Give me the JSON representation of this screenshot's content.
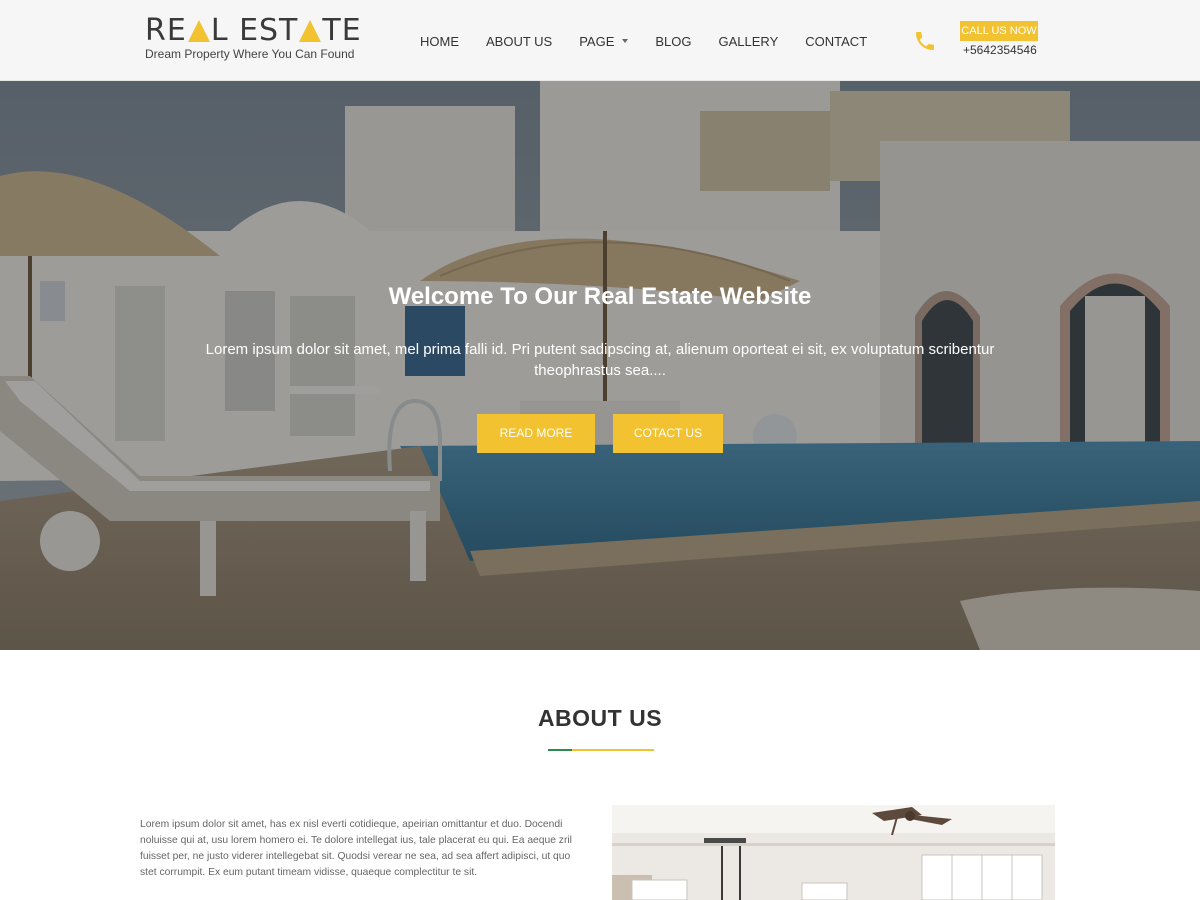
{
  "logo": {
    "title_part1": "RE",
    "title_part2": "L EST",
    "title_part3": "TE",
    "tagline": "Dream Property Where You Can Found"
  },
  "nav": {
    "items": [
      "HOME",
      "ABOUT US",
      "PAGE",
      "BLOG",
      "GALLERY",
      "CONTACT"
    ]
  },
  "contact": {
    "call_label": "CALL US NOW",
    "phone": "+5642354546",
    "icon": "phone-icon"
  },
  "hero": {
    "title": "Welcome To Our Real Estate Website",
    "text": "Lorem ipsum dolor sit amet, mel prima falli id. Pri putent sadipscing at, alienum oporteat ei sit, ex voluptatum scribentur theophrastus sea....",
    "read_more": "READ MORE",
    "contact_us": "COTACT US"
  },
  "about": {
    "title": "ABOUT US",
    "text": "Lorem ipsum dolor sit amet, has ex nisl everti cotidieque, apeirian omittantur et duo. Docendi noluisse qui at, usu lorem homero ei. Te dolore intellegat ius, tale placerat eu qui. Ea aeque zril fuisset per, ne justo viderer intellegebat sit. Quodsi verear ne sea, ad sea affert adipisci, ut quo stet corrumpit. Ex eum putant timeam vidisse, quaeque complectitur te sit."
  },
  "colors": {
    "accent": "#f2c230",
    "accent_green": "#2f8a4f",
    "header_bg": "#f6f6f6"
  }
}
